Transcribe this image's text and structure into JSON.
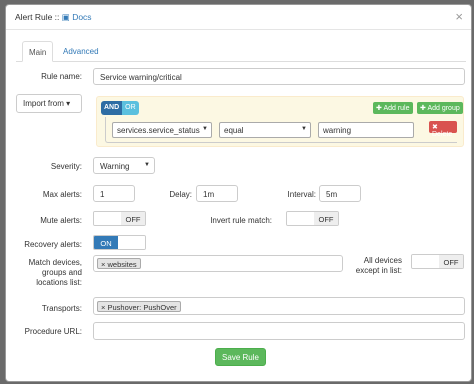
{
  "modal": {
    "title": "Alert Rule ::",
    "docs_label": "Docs",
    "close_glyph": "×"
  },
  "tabs": {
    "main": "Main",
    "advanced": "Advanced"
  },
  "form": {
    "rule_name_label": "Rule name:",
    "rule_name_value": "Service warning/critical",
    "import_from_label": "Import from ▾",
    "builder": {
      "and_label": "AND",
      "or_label": "OR",
      "add_rule": "Add rule",
      "add_group": "Add group",
      "field": "services.service_status",
      "operator": "equal",
      "value": "warning",
      "delete": "Delete"
    },
    "severity_label": "Severity:",
    "severity_value": "Warning",
    "max_alerts_label": "Max alerts:",
    "max_alerts_value": "1",
    "delay_label": "Delay:",
    "delay_value": "1m",
    "interval_label": "Interval:",
    "interval_value": "5m",
    "mute_alerts_label": "Mute alerts:",
    "mute_alerts_state": "OFF",
    "invert_label": "Invert rule match:",
    "invert_state": "OFF",
    "recovery_label": "Recovery alerts:",
    "recovery_state": "ON",
    "match_devices_label_1": "Match devices,",
    "match_devices_label_2": "groups and",
    "match_devices_label_3": "locations list:",
    "match_tag": "websites",
    "all_devices_label_1": "All devices",
    "all_devices_label_2": "except in list:",
    "all_devices_state": "OFF",
    "transports_label": "Transports:",
    "transport_tag": "Pushover: PushOver",
    "procedure_label": "Procedure URL:",
    "procedure_value": "",
    "save_label": "Save Rule"
  },
  "colors": {
    "primary": "#337ab7",
    "success": "#5cb85c",
    "danger": "#d9534f",
    "info": "#5bc0de",
    "builder_bg": "#fcf8e3"
  }
}
